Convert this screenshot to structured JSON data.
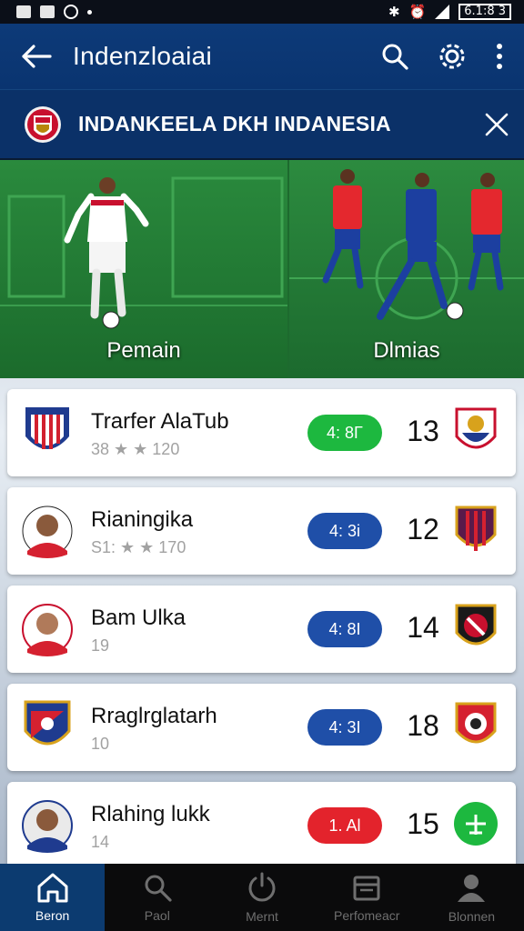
{
  "status_bar": {
    "time": "6.1:8 3"
  },
  "app_bar": {
    "title": "Indenzloaiai"
  },
  "banner": {
    "title": "INDANKEELA DKH INDANESIA"
  },
  "hero": {
    "left_label": "Pemain",
    "right_label": "Dlmias"
  },
  "matches": [
    {
      "name": "Trarfer AlaTub",
      "sub": "38 ★ ★ 120",
      "score": "4: 8Γ",
      "pill_color": "#1db83f",
      "number": "13"
    },
    {
      "name": "Rianingika",
      "sub": "S1: ★ ★ 170",
      "score": "4: 3i",
      "pill_color": "#1f4fa8",
      "number": "12"
    },
    {
      "name": "Bam Ulka",
      "sub": "19",
      "score": "4: 8I",
      "pill_color": "#1f4fa8",
      "number": "14"
    },
    {
      "name": "Rraglrglatarh",
      "sub": "10",
      "score": "4: 3I",
      "pill_color": "#1f4fa8",
      "number": "18"
    },
    {
      "name": "Rlahing lukk",
      "sub": "14",
      "score": "1. Al",
      "pill_color": "#e3232c",
      "number": "15"
    }
  ],
  "bottom_nav": [
    {
      "label": "Beron",
      "icon": "home-icon"
    },
    {
      "label": "Paol",
      "icon": "search-icon"
    },
    {
      "label": "Mernt",
      "icon": "power-icon"
    },
    {
      "label": "Perfomeacr",
      "icon": "calendar-icon"
    },
    {
      "label": "Blonnen",
      "icon": "profile-icon"
    }
  ]
}
